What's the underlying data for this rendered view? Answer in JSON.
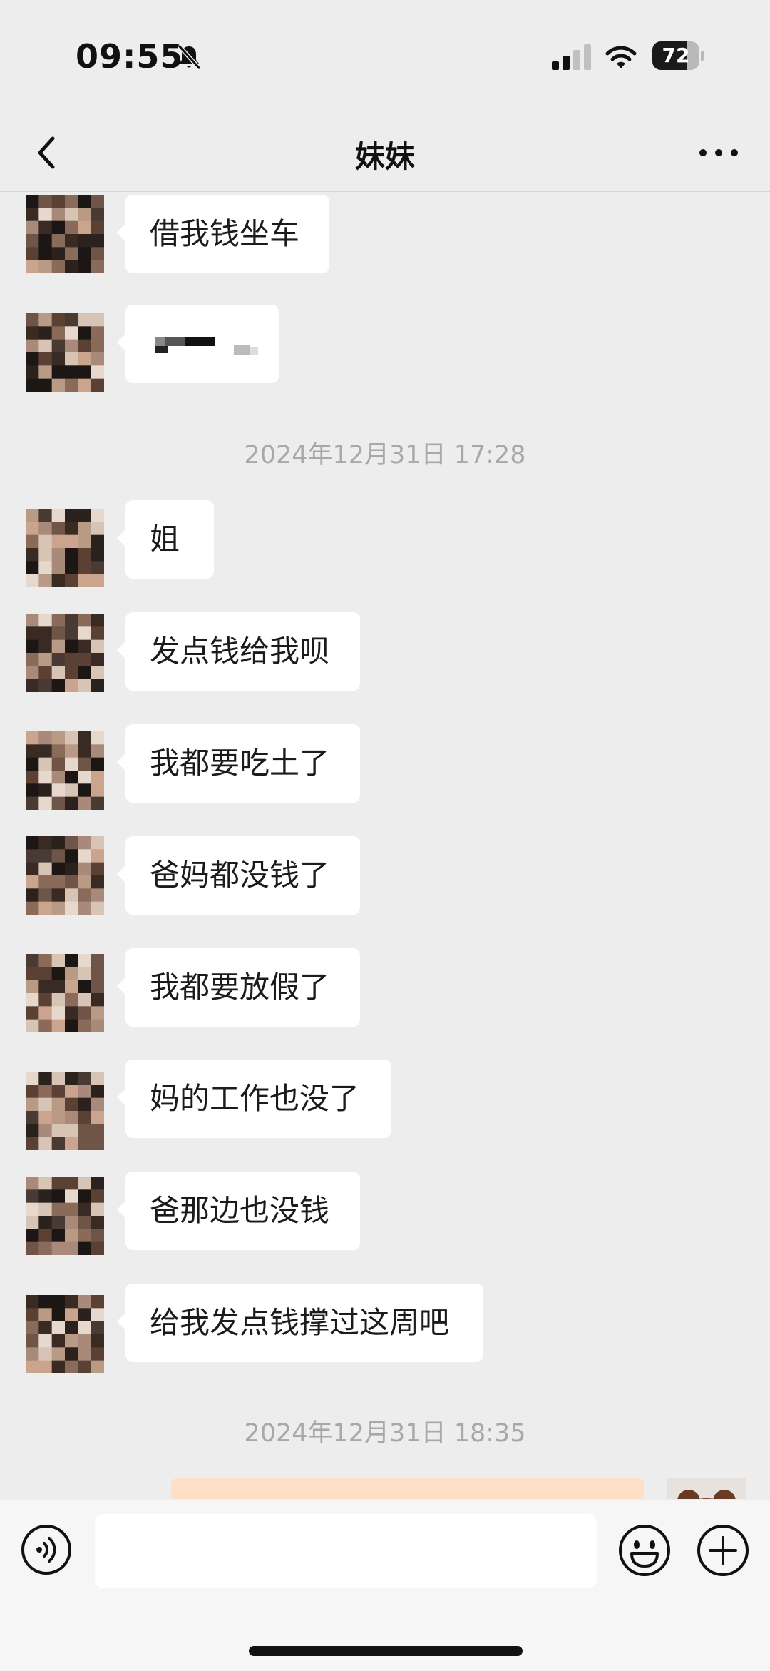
{
  "status_bar": {
    "time": "09:55",
    "battery_level": "72",
    "battery_fraction": 0.72,
    "icons": [
      "bell-muted-icon",
      "signal-icon",
      "wifi-icon",
      "battery-icon"
    ]
  },
  "nav": {
    "title": "妹妹",
    "back_icon": "chevron-left-icon",
    "more_icon": "more-dots-icon"
  },
  "messages": [
    {
      "text": "借我钱坐车"
    },
    {
      "text": ""
    },
    {
      "text": "姐"
    },
    {
      "text": "发点钱给我呗"
    },
    {
      "text": "我都要吃土了"
    },
    {
      "text": "爸妈都没钱了"
    },
    {
      "text": "我都要放假了"
    },
    {
      "text": "妈的工作也没了"
    },
    {
      "text": "爸那边也没钱"
    },
    {
      "text": "给我发点钱撑过这周吧"
    }
  ],
  "timestamps": [
    "2024年12月31日 17:28",
    "2024年12月31日 18:35"
  ],
  "input_bar": {
    "placeholder": "",
    "icons": [
      "voice-icon",
      "emoji-icon",
      "plus-icon"
    ]
  },
  "colors": {
    "background": "#ededed",
    "bubble_incoming": "#ffffff",
    "bubble_outgoing": "#ffdfc5",
    "timestamp": "#a8a8a8"
  }
}
